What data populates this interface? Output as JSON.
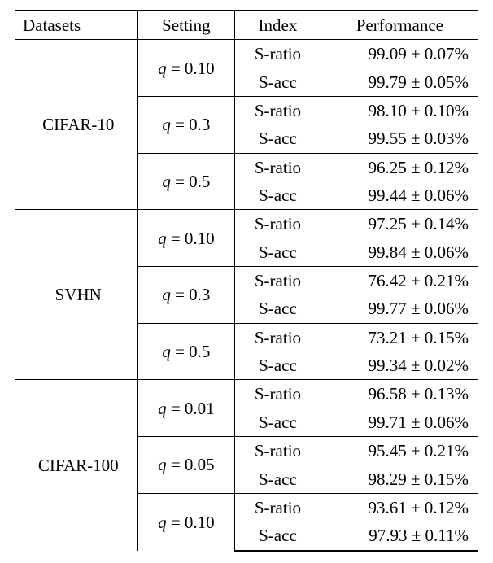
{
  "headers": {
    "datasets": "Datasets",
    "setting": "Setting",
    "index": "Index",
    "performance": "Performance"
  },
  "index_labels": {
    "sratio": "S-ratio",
    "sacc": "S-acc"
  },
  "chart_data": {
    "type": "table",
    "title": "",
    "columns": [
      "Datasets",
      "Setting",
      "Index",
      "Performance"
    ],
    "datasets": [
      {
        "name": "CIFAR-10",
        "settings": [
          {
            "q": 0.1,
            "sratio": {
              "mean": 99.09,
              "std": 0.07
            },
            "sacc": {
              "mean": 99.79,
              "std": 0.05
            }
          },
          {
            "q": 0.3,
            "sratio": {
              "mean": 98.1,
              "std": 0.1
            },
            "sacc": {
              "mean": 99.55,
              "std": 0.03
            }
          },
          {
            "q": 0.5,
            "sratio": {
              "mean": 96.25,
              "std": 0.12
            },
            "sacc": {
              "mean": 99.44,
              "std": 0.06
            }
          }
        ]
      },
      {
        "name": "SVHN",
        "settings": [
          {
            "q": 0.1,
            "sratio": {
              "mean": 97.25,
              "std": 0.14
            },
            "sacc": {
              "mean": 99.84,
              "std": 0.06
            }
          },
          {
            "q": 0.3,
            "sratio": {
              "mean": 76.42,
              "std": 0.21
            },
            "sacc": {
              "mean": 99.77,
              "std": 0.06
            }
          },
          {
            "q": 0.5,
            "sratio": {
              "mean": 73.21,
              "std": 0.15
            },
            "sacc": {
              "mean": 99.34,
              "std": 0.02
            }
          }
        ]
      },
      {
        "name": "CIFAR-100",
        "settings": [
          {
            "q": 0.01,
            "sratio": {
              "mean": 96.58,
              "std": 0.13
            },
            "sacc": {
              "mean": 99.71,
              "std": 0.06
            }
          },
          {
            "q": 0.05,
            "sratio": {
              "mean": 95.45,
              "std": 0.21
            },
            "sacc": {
              "mean": 98.29,
              "std": 0.15
            }
          },
          {
            "q": 0.1,
            "sratio": {
              "mean": 93.61,
              "std": 0.12
            },
            "sacc": {
              "mean": 97.93,
              "std": 0.11
            }
          }
        ]
      }
    ]
  }
}
